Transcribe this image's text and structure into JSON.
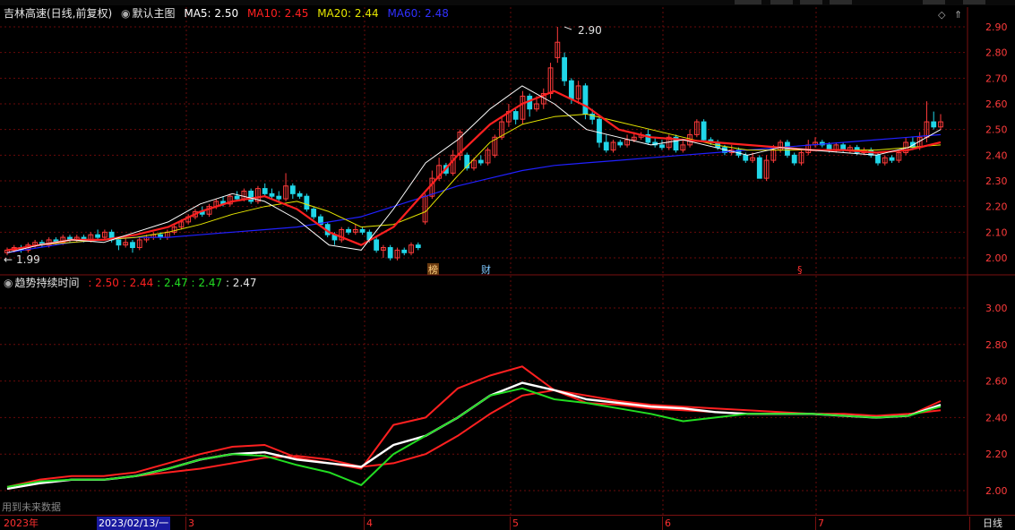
{
  "stock_title": "吉林高速(日线,前复权)",
  "main_indicator": {
    "name": "默认主图",
    "ma5": "MA5: 2.50",
    "ma10": "MA10: 2.45",
    "ma20": "MA20: 2.44",
    "ma60": "MA60: 2.48"
  },
  "sub_indicator": {
    "name": "趋势持续时间",
    "v1": ": 2.50",
    "v2": ": 2.44",
    "v3": ": 2.47",
    "v4": ": 2.47",
    "v5": ": 2.47"
  },
  "colors": {
    "up": "#ff3b3b",
    "down": "#21d6e8",
    "ma5": "#ffffff",
    "ma10": "#ff2020",
    "ma20": "#e6e600",
    "ma60": "#2020ff",
    "green": "#22dd22",
    "grid": "#6a0a0a"
  },
  "price_axis": [
    "2.90",
    "2.80",
    "2.70",
    "2.60",
    "2.50",
    "2.40",
    "2.30",
    "2.20",
    "2.10",
    "2.00"
  ],
  "sub_axis": [
    "3.00",
    "2.80",
    "2.60",
    "2.40",
    "2.20",
    "2.00"
  ],
  "annotations": {
    "high": "2.90",
    "low": "1.99",
    "markers": [
      "榜",
      "财",
      "§"
    ]
  },
  "future_data_label": "用到未来数据",
  "date_labels": {
    "year": "2023年",
    "cursor": "2023/02/13/一",
    "months": [
      "3",
      "4",
      "5",
      "6",
      "7"
    ],
    "period": "日线"
  },
  "chart_data": {
    "type": "line",
    "title": "吉林高速(日线,前复权)",
    "ylim": [
      1.95,
      2.95
    ],
    "candles": [
      [
        2.02,
        2.03,
        2.04,
        2.01
      ],
      [
        2.03,
        2.04,
        2.05,
        2.02
      ],
      [
        2.04,
        2.03,
        2.05,
        2.02
      ],
      [
        2.03,
        2.05,
        2.06,
        2.02
      ],
      [
        2.05,
        2.06,
        2.07,
        2.04
      ],
      [
        2.06,
        2.05,
        2.07,
        2.04
      ],
      [
        2.05,
        2.07,
        2.08,
        2.04
      ],
      [
        2.07,
        2.06,
        2.08,
        2.05
      ],
      [
        2.06,
        2.08,
        2.09,
        2.05
      ],
      [
        2.08,
        2.07,
        2.09,
        2.06
      ],
      [
        2.07,
        2.08,
        2.09,
        2.06
      ],
      [
        2.08,
        2.07,
        2.09,
        2.06
      ],
      [
        2.07,
        2.09,
        2.1,
        2.06
      ],
      [
        2.09,
        2.08,
        2.11,
        2.07
      ],
      [
        2.08,
        2.1,
        2.11,
        2.07
      ],
      [
        2.1,
        2.07,
        2.11,
        2.06
      ],
      [
        2.07,
        2.05,
        2.08,
        2.03
      ],
      [
        2.05,
        2.06,
        2.08,
        2.04
      ],
      [
        2.06,
        2.04,
        2.07,
        2.02
      ],
      [
        2.04,
        2.07,
        2.08,
        2.03
      ],
      [
        2.07,
        2.08,
        2.09,
        2.06
      ],
      [
        2.08,
        2.09,
        2.1,
        2.07
      ],
      [
        2.09,
        2.08,
        2.1,
        2.07
      ],
      [
        2.08,
        2.1,
        2.11,
        2.07
      ],
      [
        2.1,
        2.12,
        2.13,
        2.09
      ],
      [
        2.12,
        2.14,
        2.15,
        2.11
      ],
      [
        2.14,
        2.16,
        2.17,
        2.13
      ],
      [
        2.16,
        2.18,
        2.19,
        2.15
      ],
      [
        2.18,
        2.17,
        2.2,
        2.16
      ],
      [
        2.17,
        2.2,
        2.21,
        2.16
      ],
      [
        2.2,
        2.22,
        2.23,
        2.19
      ],
      [
        2.22,
        2.21,
        2.24,
        2.2
      ],
      [
        2.21,
        2.24,
        2.25,
        2.2
      ],
      [
        2.24,
        2.23,
        2.26,
        2.22
      ],
      [
        2.23,
        2.26,
        2.27,
        2.22
      ],
      [
        2.26,
        2.22,
        2.27,
        2.21
      ],
      [
        2.22,
        2.27,
        2.28,
        2.21
      ],
      [
        2.27,
        2.25,
        2.29,
        2.24
      ],
      [
        2.25,
        2.24,
        2.27,
        2.23
      ],
      [
        2.24,
        2.23,
        2.26,
        2.22
      ],
      [
        2.23,
        2.28,
        2.33,
        2.22
      ],
      [
        2.28,
        2.25,
        2.29,
        2.23
      ],
      [
        2.25,
        2.24,
        2.26,
        2.23
      ],
      [
        2.24,
        2.19,
        2.25,
        2.18
      ],
      [
        2.19,
        2.16,
        2.2,
        2.15
      ],
      [
        2.16,
        2.13,
        2.17,
        2.12
      ],
      [
        2.13,
        2.09,
        2.14,
        2.08
      ],
      [
        2.09,
        2.07,
        2.1,
        2.05
      ],
      [
        2.07,
        2.11,
        2.12,
        2.06
      ],
      [
        2.11,
        2.1,
        2.12,
        2.09
      ],
      [
        2.1,
        2.11,
        2.13,
        2.09
      ],
      [
        2.11,
        2.1,
        2.12,
        2.09
      ],
      [
        2.1,
        2.07,
        2.11,
        2.06
      ],
      [
        2.07,
        2.03,
        2.08,
        2.02
      ],
      [
        2.03,
        2.04,
        2.05,
        2.0
      ],
      [
        2.04,
        2.0,
        2.05,
        1.99
      ],
      [
        2.0,
        2.03,
        2.04,
        1.99
      ],
      [
        2.03,
        2.02,
        2.04,
        2.01
      ],
      [
        2.02,
        2.05,
        2.06,
        2.01
      ],
      [
        2.05,
        2.04,
        2.06,
        2.03
      ],
      [
        2.14,
        2.24,
        2.25,
        2.13
      ],
      [
        2.24,
        2.31,
        2.34,
        2.23
      ],
      [
        2.31,
        2.36,
        2.39,
        2.3
      ],
      [
        2.36,
        2.33,
        2.37,
        2.32
      ],
      [
        2.33,
        2.4,
        2.42,
        2.32
      ],
      [
        2.4,
        2.49,
        2.5,
        2.38
      ],
      [
        2.4,
        2.35,
        2.41,
        2.34
      ],
      [
        2.35,
        2.38,
        2.39,
        2.34
      ],
      [
        2.38,
        2.37,
        2.4,
        2.36
      ],
      [
        2.37,
        2.42,
        2.43,
        2.36
      ],
      [
        2.4,
        2.47,
        2.48,
        2.39
      ],
      [
        2.47,
        2.53,
        2.55,
        2.46
      ],
      [
        2.53,
        2.57,
        2.6,
        2.51
      ],
      [
        2.57,
        2.54,
        2.58,
        2.52
      ],
      [
        2.54,
        2.63,
        2.65,
        2.52
      ],
      [
        2.63,
        2.58,
        2.64,
        2.55
      ],
      [
        2.58,
        2.6,
        2.63,
        2.57
      ],
      [
        2.6,
        2.64,
        2.66,
        2.58
      ],
      [
        2.64,
        2.74,
        2.76,
        2.62
      ],
      [
        2.78,
        2.84,
        2.9,
        2.76
      ],
      [
        2.78,
        2.69,
        2.8,
        2.67
      ],
      [
        2.69,
        2.62,
        2.7,
        2.6
      ],
      [
        2.62,
        2.67,
        2.69,
        2.6
      ],
      [
        2.67,
        2.56,
        2.68,
        2.54
      ],
      [
        2.56,
        2.54,
        2.58,
        2.52
      ],
      [
        2.54,
        2.45,
        2.55,
        2.43
      ],
      [
        2.45,
        2.42,
        2.48,
        2.41
      ],
      [
        2.42,
        2.45,
        2.46,
        2.41
      ],
      [
        2.45,
        2.44,
        2.46,
        2.43
      ],
      [
        2.44,
        2.46,
        2.48,
        2.43
      ],
      [
        2.46,
        2.47,
        2.49,
        2.45
      ],
      [
        2.47,
        2.48,
        2.49,
        2.46
      ],
      [
        2.48,
        2.45,
        2.5,
        2.44
      ],
      [
        2.45,
        2.44,
        2.47,
        2.43
      ],
      [
        2.44,
        2.43,
        2.46,
        2.42
      ],
      [
        2.43,
        2.47,
        2.48,
        2.42
      ],
      [
        2.47,
        2.42,
        2.48,
        2.41
      ],
      [
        2.42,
        2.44,
        2.46,
        2.41
      ],
      [
        2.44,
        2.48,
        2.5,
        2.43
      ],
      [
        2.48,
        2.53,
        2.54,
        2.47
      ],
      [
        2.53,
        2.46,
        2.54,
        2.45
      ],
      [
        2.46,
        2.45,
        2.47,
        2.44
      ],
      [
        2.45,
        2.43,
        2.46,
        2.42
      ],
      [
        2.43,
        2.41,
        2.44,
        2.4
      ],
      [
        2.41,
        2.42,
        2.44,
        2.4
      ],
      [
        2.42,
        2.4,
        2.43,
        2.39
      ],
      [
        2.4,
        2.38,
        2.41,
        2.37
      ],
      [
        2.38,
        2.39,
        2.41,
        2.37
      ],
      [
        2.39,
        2.31,
        2.4,
        2.31
      ],
      [
        2.31,
        2.38,
        2.4,
        2.3
      ],
      [
        2.38,
        2.42,
        2.44,
        2.37
      ],
      [
        2.42,
        2.45,
        2.46,
        2.41
      ],
      [
        2.45,
        2.4,
        2.46,
        2.39
      ],
      [
        2.4,
        2.37,
        2.41,
        2.36
      ],
      [
        2.37,
        2.41,
        2.42,
        2.36
      ],
      [
        2.41,
        2.44,
        2.46,
        2.4
      ],
      [
        2.44,
        2.45,
        2.47,
        2.43
      ],
      [
        2.45,
        2.44,
        2.46,
        2.43
      ],
      [
        2.44,
        2.42,
        2.45,
        2.41
      ],
      [
        2.42,
        2.44,
        2.45,
        2.41
      ],
      [
        2.44,
        2.42,
        2.45,
        2.41
      ],
      [
        2.42,
        2.43,
        2.44,
        2.41
      ],
      [
        2.43,
        2.41,
        2.44,
        2.4
      ],
      [
        2.41,
        2.42,
        2.43,
        2.4
      ],
      [
        2.42,
        2.4,
        2.43,
        2.39
      ],
      [
        2.4,
        2.37,
        2.41,
        2.36
      ],
      [
        2.37,
        2.39,
        2.4,
        2.36
      ],
      [
        2.39,
        2.38,
        2.4,
        2.37
      ],
      [
        2.38,
        2.41,
        2.42,
        2.37
      ],
      [
        2.41,
        2.45,
        2.47,
        2.4
      ],
      [
        2.45,
        2.43,
        2.47,
        2.42
      ],
      [
        2.43,
        2.47,
        2.49,
        2.42
      ],
      [
        2.47,
        2.53,
        2.61,
        2.45
      ],
      [
        2.53,
        2.51,
        2.57,
        2.5
      ],
      [
        2.51,
        2.53,
        2.56,
        2.5
      ]
    ],
    "series": [
      {
        "name": "MA60",
        "values": [
          2.02,
          2.04,
          2.06,
          2.07,
          2.08,
          2.08,
          2.09,
          2.1,
          2.11,
          2.12,
          2.14,
          2.16,
          2.2,
          2.24,
          2.28,
          2.31,
          2.34,
          2.36,
          2.37,
          2.38,
          2.39,
          2.4,
          2.41,
          2.42,
          2.43,
          2.44,
          2.45,
          2.46,
          2.47,
          2.48
        ]
      },
      {
        "name": "MA20",
        "values": [
          2.03,
          2.05,
          2.06,
          2.07,
          2.08,
          2.1,
          2.13,
          2.17,
          2.2,
          2.22,
          2.18,
          2.12,
          2.13,
          2.18,
          2.32,
          2.45,
          2.52,
          2.55,
          2.56,
          2.53,
          2.5,
          2.47,
          2.44,
          2.42,
          2.42,
          2.42,
          2.42,
          2.42,
          2.43,
          2.44
        ]
      },
      {
        "name": "MA10",
        "values": [
          2.03,
          2.05,
          2.07,
          2.07,
          2.09,
          2.12,
          2.18,
          2.22,
          2.24,
          2.19,
          2.1,
          2.05,
          2.12,
          2.26,
          2.4,
          2.52,
          2.6,
          2.65,
          2.59,
          2.5,
          2.47,
          2.46,
          2.45,
          2.44,
          2.43,
          2.42,
          2.42,
          2.41,
          2.42,
          2.45
        ]
      },
      {
        "name": "MA5",
        "values": [
          2.02,
          2.05,
          2.07,
          2.06,
          2.1,
          2.14,
          2.21,
          2.25,
          2.22,
          2.15,
          2.05,
          2.03,
          2.19,
          2.37,
          2.46,
          2.58,
          2.67,
          2.6,
          2.5,
          2.47,
          2.44,
          2.46,
          2.43,
          2.4,
          2.43,
          2.42,
          2.41,
          2.4,
          2.43,
          2.5
        ]
      }
    ],
    "sub_series": [
      {
        "name": "red",
        "values": [
          2.02,
          2.06,
          2.08,
          2.08,
          2.1,
          2.15,
          2.2,
          2.24,
          2.25,
          2.18,
          2.15,
          2.12,
          2.36,
          2.4,
          2.56,
          2.63,
          2.68,
          2.55,
          2.48,
          2.47,
          2.45,
          2.44,
          2.43,
          2.42,
          2.42,
          2.42,
          2.41,
          2.4,
          2.41,
          2.49
        ]
      },
      {
        "name": "red-lower",
        "values": [
          2.01,
          2.04,
          2.06,
          2.06,
          2.08,
          2.1,
          2.12,
          2.15,
          2.18,
          2.19,
          2.17,
          2.13,
          2.15,
          2.2,
          2.3,
          2.42,
          2.52,
          2.55,
          2.52,
          2.49,
          2.47,
          2.46,
          2.45,
          2.44,
          2.43,
          2.42,
          2.42,
          2.41,
          2.42,
          2.44
        ]
      },
      {
        "name": "white",
        "values": [
          2.01,
          2.04,
          2.06,
          2.06,
          2.08,
          2.12,
          2.17,
          2.2,
          2.21,
          2.17,
          2.15,
          2.13,
          2.25,
          2.3,
          2.4,
          2.52,
          2.59,
          2.55,
          2.5,
          2.48,
          2.46,
          2.45,
          2.43,
          2.42,
          2.42,
          2.42,
          2.41,
          2.4,
          2.41,
          2.47
        ]
      },
      {
        "name": "green",
        "values": [
          2.02,
          2.05,
          2.06,
          2.06,
          2.08,
          2.12,
          2.17,
          2.2,
          2.19,
          2.14,
          2.1,
          2.03,
          2.2,
          2.3,
          2.4,
          2.52,
          2.56,
          2.5,
          2.48,
          2.45,
          2.42,
          2.38,
          2.4,
          2.42,
          2.42,
          2.42,
          2.41,
          2.4,
          2.41,
          2.46
        ]
      }
    ]
  }
}
